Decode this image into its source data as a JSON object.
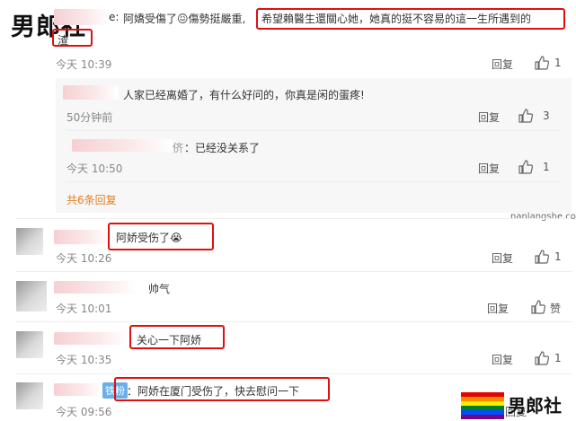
{
  "watermark_top": "男郎社",
  "watermark_bottom": {
    "text": "男郎社",
    "url": "nanlangshe.com"
  },
  "top_comment": {
    "name_suffix": "e:",
    "text_prefix": "阿嬌受傷了😖傷勢挺嚴重,",
    "text_highlight": "希望賴醫生還關心她，她真的挺不容易的這一生所遇到的",
    "text_line2": "渣",
    "time": "今天 10:39",
    "reply": "回复",
    "likes": "1"
  },
  "sub_replies": [
    {
      "text": "人家已经离婚了，有什么好问的，你真是闲的蛋疼!",
      "time": "50分钟前",
      "reply": "回复",
      "likes": "3"
    },
    {
      "name_suffix": "侪",
      "text": "：已经没关系了",
      "time": "今天 10:50",
      "reply": "回复",
      "likes": "1"
    }
  ],
  "more_replies": "共6条回复",
  "comments": [
    {
      "text": "阿娇受伤了😭",
      "time": "今天 10:26",
      "reply": "回复",
      "likes": "1"
    },
    {
      "text": "帅气",
      "time": "今天 10:01",
      "reply": "回复",
      "likes": "赞"
    },
    {
      "text": "关心一下阿娇",
      "time": "今天 10:35",
      "reply": "回复",
      "likes": "1"
    },
    {
      "badge": "铁粉",
      "text": "：阿娇在厦门受伤了，快去慰问一下",
      "time": "今天 09:56",
      "reply": "回复",
      "likes": ""
    }
  ],
  "colors": {
    "highlight_box": "#e01010",
    "more_link": "#e67e22",
    "badge": "#6ab0e8"
  }
}
